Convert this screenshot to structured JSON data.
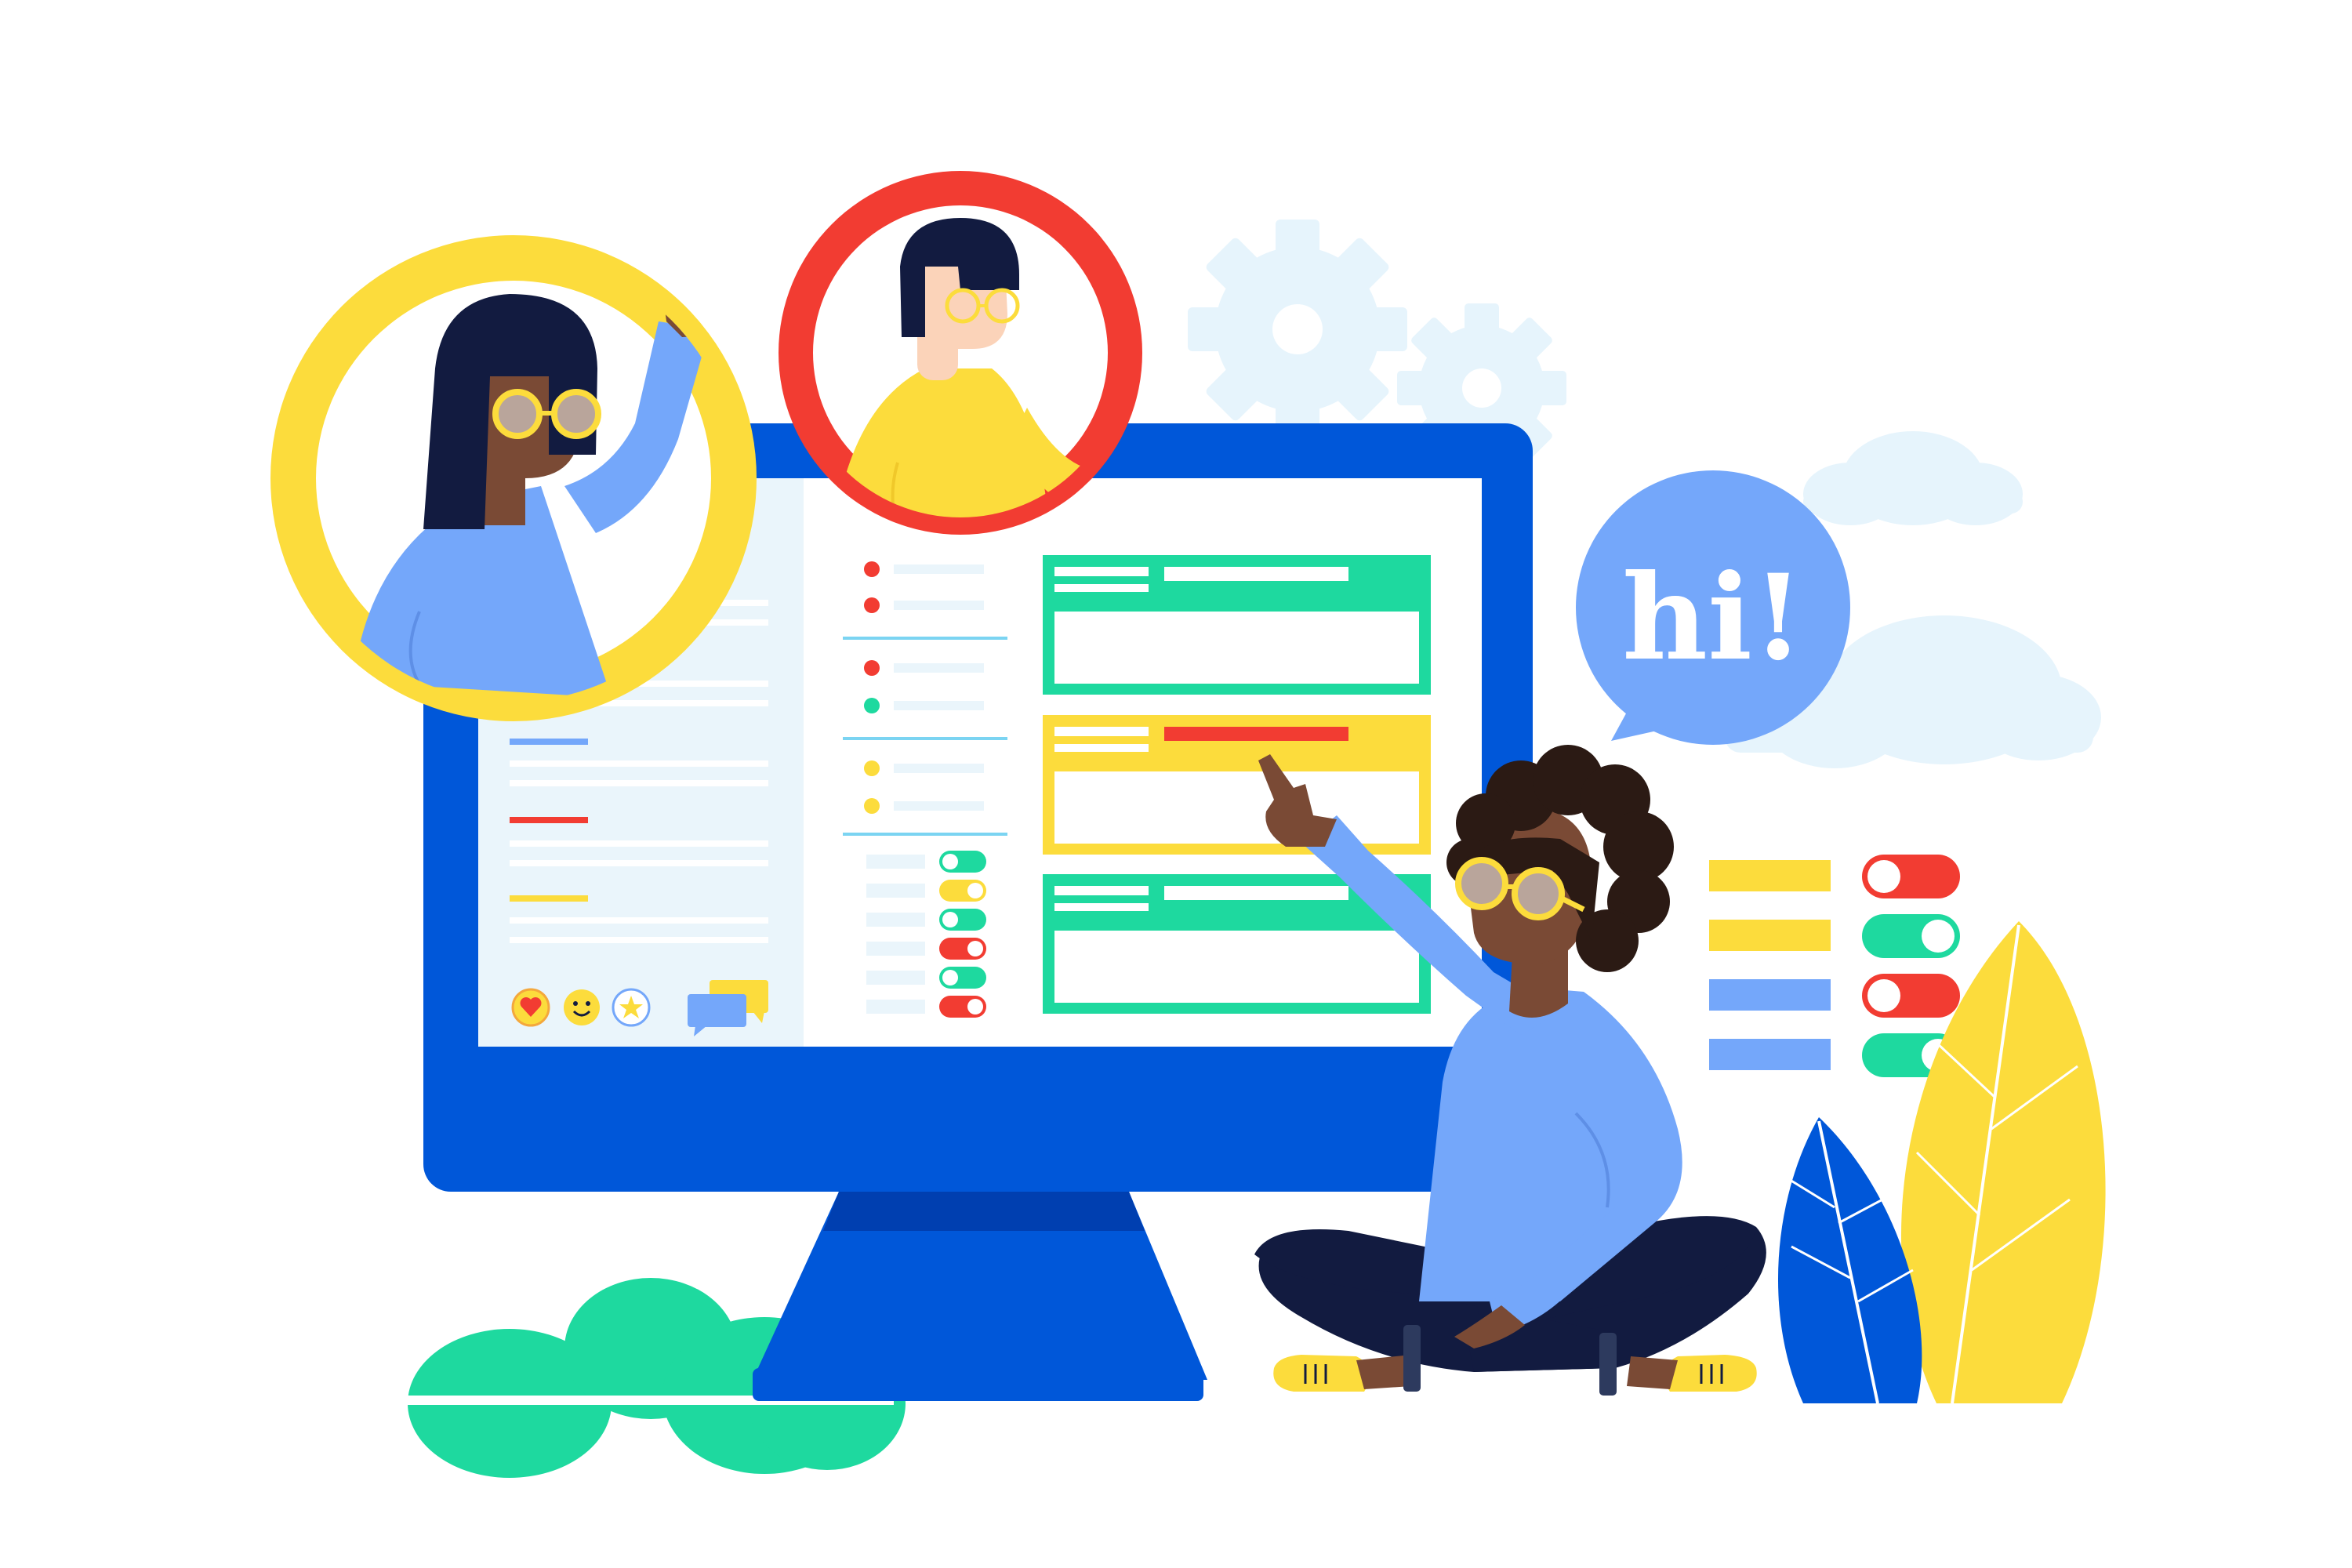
{
  "illustration": {
    "speech_bubble": {
      "text": "hi!"
    },
    "colors": {
      "monitor": "#0057d9",
      "monitor_dark": "#003fb0",
      "screen": "#ffffff",
      "sidebar": "#eaf5fb",
      "green": "#1ed99f",
      "yellow": "#fcdc3c",
      "red": "#f23c32",
      "light_blue": "#74a7fa",
      "navy": "#121b40",
      "skin_dark": "#7a4a35",
      "skin_light": "#fbd3b9",
      "cloud": "#e6f4fc"
    },
    "icons": [
      "heart-icon",
      "smiley-icon",
      "star-icon",
      "chat-icon",
      "gear-icon",
      "toggle-icon",
      "leaf-icon",
      "cloud-icon"
    ]
  }
}
